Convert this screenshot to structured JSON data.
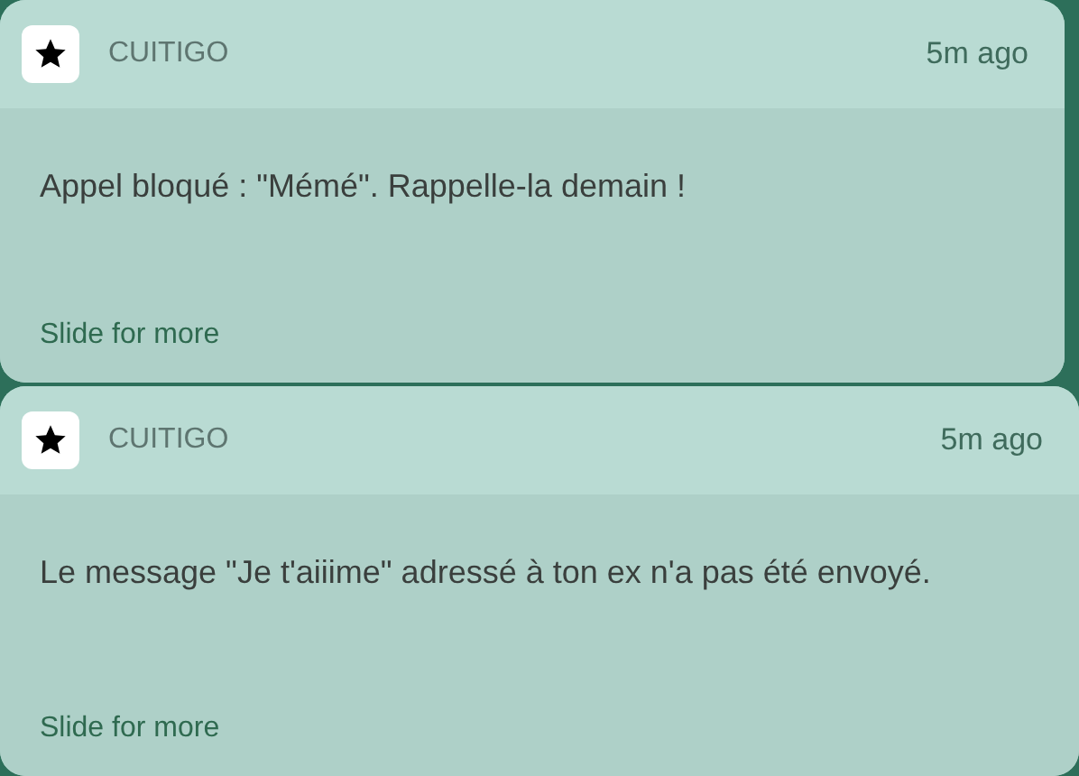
{
  "notifications": [
    {
      "app_name": "CUITIGO",
      "time": "5m ago",
      "message": "Appel bloqué : \"Mémé\". Rappelle-la demain !",
      "hint": "Slide for more"
    },
    {
      "app_name": "CUITIGO",
      "time": "5m ago",
      "message": "Le message \"Je t'aiiime\" adressé à ton ex n'a pas été envoyé.",
      "hint": "Slide for more"
    }
  ]
}
